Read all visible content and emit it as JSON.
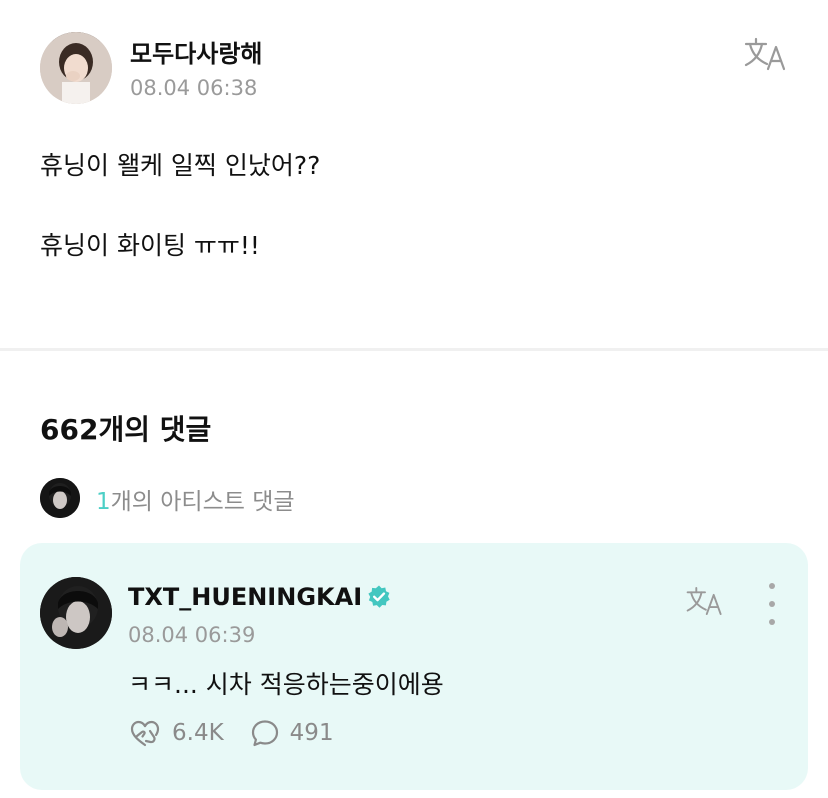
{
  "post": {
    "author": "모두다사랑해",
    "timestamp": "08.04 06:38",
    "lines": [
      "휴닝이 왤케 일찍 인났어??",
      "휴닝이 화이팅 ㅠㅠ!!"
    ],
    "translate_icon": "translate-icon"
  },
  "comments_section": {
    "count_label": "662개의 댓글",
    "artist_filter": {
      "count": "1",
      "label": "개의 아티스트 댓글"
    }
  },
  "artist_comment": {
    "author": "TXT_HUENINGKAI",
    "verified_icon": "verified-badge-icon",
    "timestamp": "08.04 06:39",
    "text": "ㅋㅋ... 시차 적응하는중이에용",
    "likes": "6.4K",
    "replies": "491",
    "like_icon": "heart-hands-icon",
    "reply_icon": "chat-bubble-icon",
    "more_icon": "more-vertical-icon"
  },
  "colors": {
    "accent": "#4ccfc6",
    "card_background": "#e8f9f7",
    "muted_text": "#9a9a9a",
    "verified": "#43c7c0"
  }
}
